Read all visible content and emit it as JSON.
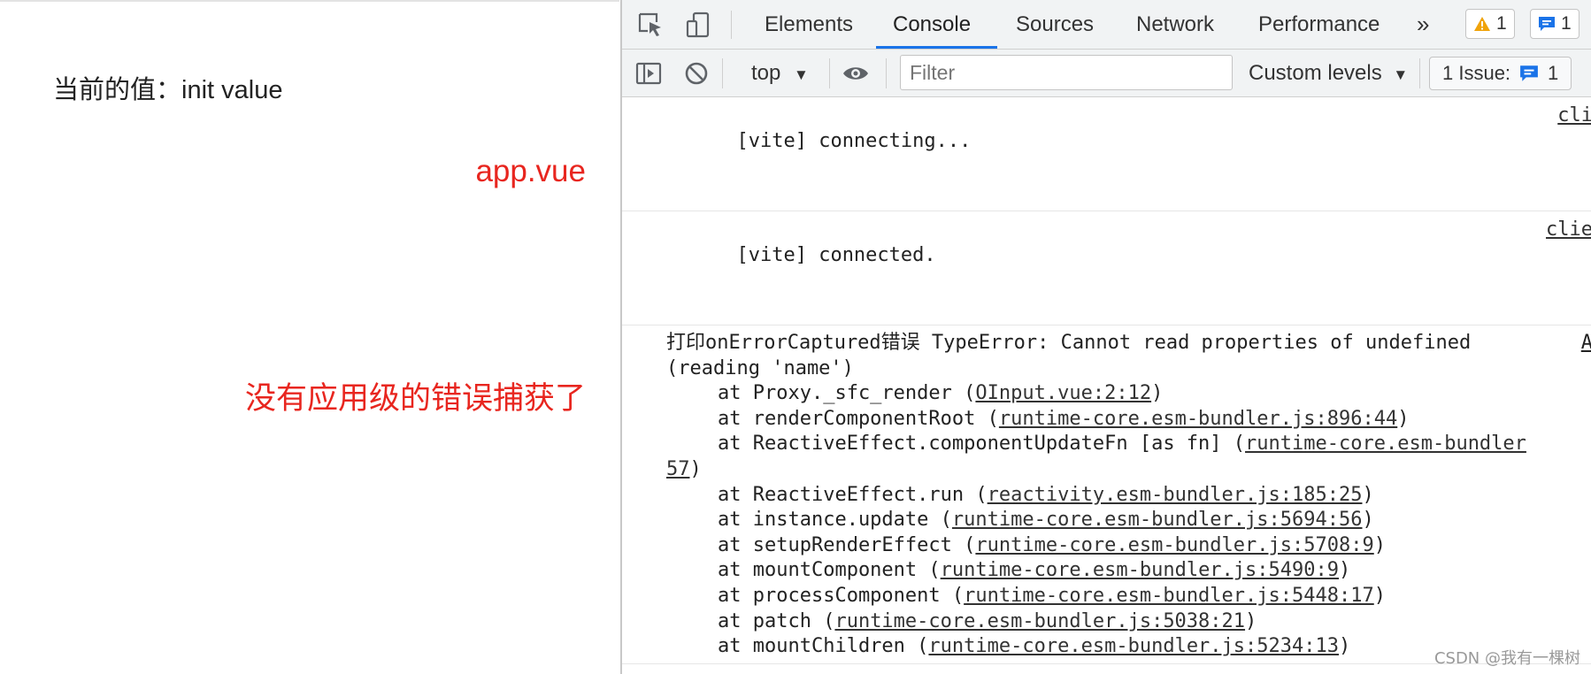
{
  "page": {
    "current_value": "当前的值：init value",
    "note_app": "app.vue",
    "note_no_handler": "没有应用级的错误捕获了"
  },
  "devtools": {
    "tabs": [
      "Elements",
      "Console",
      "Sources",
      "Network",
      "Performance"
    ],
    "active_tab": "Console",
    "more_tabs": "»",
    "warnings_count": "1",
    "messages_count": "1",
    "context": "top",
    "filter_placeholder": "Filter",
    "levels": "Custom levels",
    "issues_label": "1 Issue:",
    "issues_count": "1",
    "colors": {
      "accent": "#1a73e8",
      "warning": "#f0a30a",
      "annotation": "#e8261f"
    }
  },
  "console": {
    "messages": [
      {
        "text": "[vite] connecting...",
        "source": "cli"
      },
      {
        "text": "[vite] connected.",
        "source": "clie"
      }
    ],
    "error": {
      "line1": "打印onErrorCaptured错误 TypeError: Cannot read properties of undefined",
      "line1_source": "A",
      "line2": "(reading 'name')",
      "stack": [
        {
          "prefix": "at Proxy._sfc_render (",
          "link": "OInput.vue:2:12",
          "suffix": ")"
        },
        {
          "prefix": "at renderComponentRoot (",
          "link": "runtime-core.esm-bundler.js:896:44",
          "suffix": ")"
        },
        {
          "prefix": "at ReactiveEffect.componentUpdateFn [as fn] (",
          "link": "runtime-core.esm-bundler",
          "suffix": ""
        }
      ],
      "wrap_link": "57",
      "wrap_suffix": ")",
      "stack_rest": [
        {
          "prefix": "at ReactiveEffect.run (",
          "link": "reactivity.esm-bundler.js:185:25",
          "suffix": ")"
        },
        {
          "prefix": "at instance.update (",
          "link": "runtime-core.esm-bundler.js:5694:56",
          "suffix": ")"
        },
        {
          "prefix": "at setupRenderEffect (",
          "link": "runtime-core.esm-bundler.js:5708:9",
          "suffix": ")"
        },
        {
          "prefix": "at mountComponent (",
          "link": "runtime-core.esm-bundler.js:5490:9",
          "suffix": ")"
        },
        {
          "prefix": "at processComponent (",
          "link": "runtime-core.esm-bundler.js:5448:17",
          "suffix": ")"
        },
        {
          "prefix": "at patch (",
          "link": "runtime-core.esm-bundler.js:5038:21",
          "suffix": ")"
        },
        {
          "prefix": "at mountChildren (",
          "link": "runtime-core.esm-bundler.js:5234:13",
          "suffix": ")"
        }
      ]
    }
  },
  "watermark": "CSDN @我有一棵树"
}
